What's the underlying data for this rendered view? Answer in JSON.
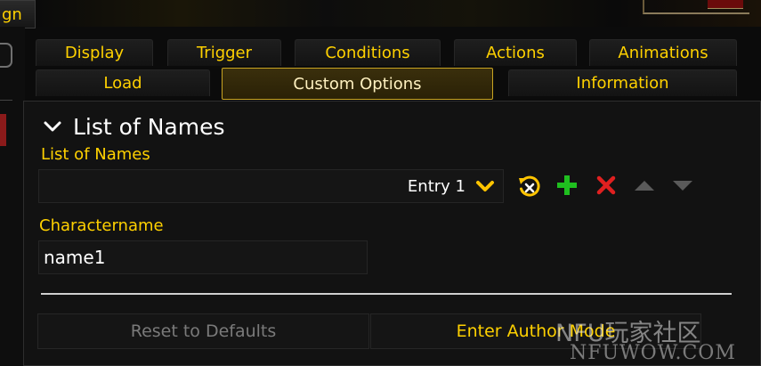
{
  "window": {
    "title_fragment": "gn"
  },
  "tabs": {
    "row1": [
      {
        "label": "Display"
      },
      {
        "label": "Trigger"
      },
      {
        "label": "Conditions"
      },
      {
        "label": "Actions"
      },
      {
        "label": "Animations"
      }
    ],
    "row2": [
      {
        "label": "Load"
      },
      {
        "label": "Custom Options",
        "selected": true
      },
      {
        "label": "Information"
      }
    ]
  },
  "group": {
    "title": "List of Names",
    "list_label": "List of Names",
    "entry_selected": "Entry 1",
    "icons": [
      "reset-entry-icon",
      "add-icon",
      "delete-icon",
      "move-up-icon",
      "move-down-icon"
    ],
    "field_label": "Charactername",
    "field_value": "name1"
  },
  "buttons": {
    "reset": "Reset to Defaults",
    "author_mode": "Enter Author Mode"
  },
  "watermark": {
    "logo": "NFU玩家社区",
    "url": "NFUWOW.COM"
  },
  "colors": {
    "gold": "#ffd100",
    "selected_tab_border": "#c8a422",
    "add_green": "#1fbf1f",
    "delete_red": "#e02020",
    "disabled_arrow": "#5a5a5a"
  }
}
